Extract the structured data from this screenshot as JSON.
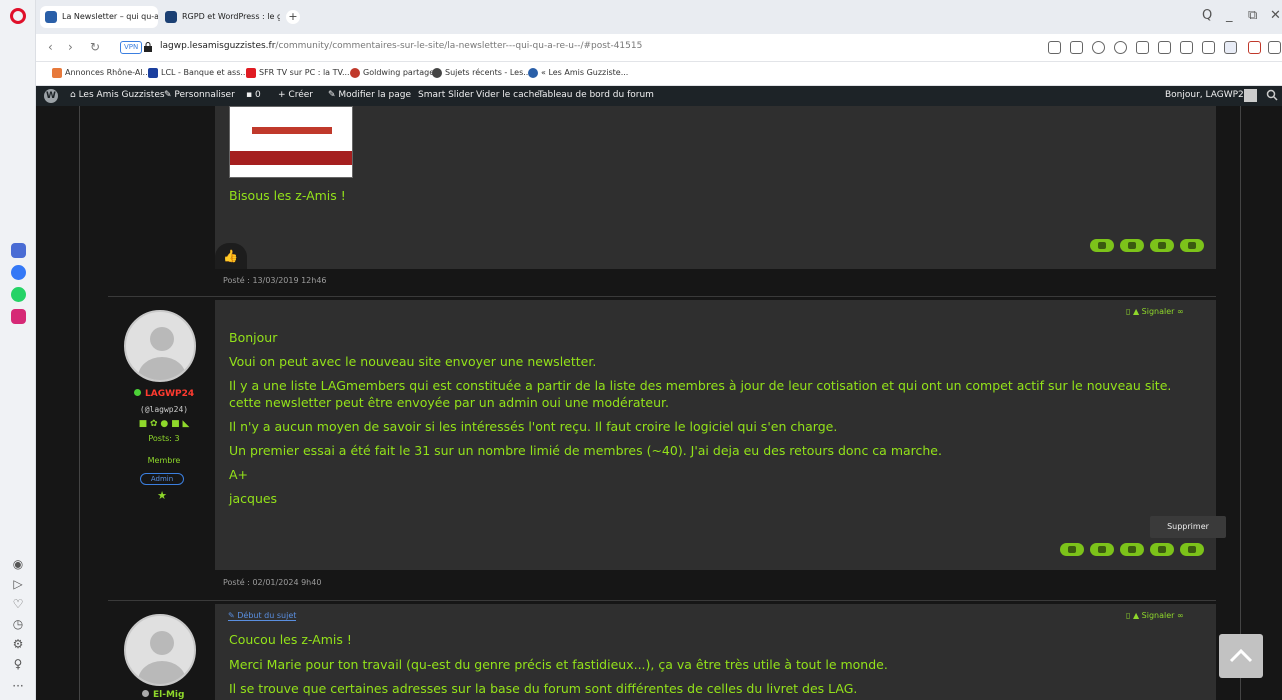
{
  "browser": {
    "tabs": [
      {
        "label": "La Newsletter – qui qu-a-r…",
        "active": true
      },
      {
        "label": "RGPD et WordPress : le gu…",
        "active": false
      }
    ],
    "new_tab": "+",
    "window_controls": {
      "search": "Q",
      "minimize": "_",
      "restore": "⧉",
      "close": "✕"
    },
    "vpn": "VPN",
    "url_domain": "lagwp.lesamisguzzistes.fr",
    "url_path": "/community/commentaires-sur-le-site/la-newsletter---qui-qu-a-re-u--/#post-41515"
  },
  "bookmarks": [
    {
      "label": "Annonces Rhône-Al...",
      "color": "#e7793b"
    },
    {
      "label": "LCL - Banque et ass...",
      "color": "#1b3f9e"
    },
    {
      "label": "SFR TV sur PC : la TV...",
      "color": "#e01b22"
    },
    {
      "label": "Goldwing partage",
      "color": "#c0392b"
    },
    {
      "label": "Sujets récents - Les...",
      "color": "#444444"
    },
    {
      "label": "« Les Amis Guzziste...",
      "color": "#2a5fa8"
    }
  ],
  "wpbar": {
    "site": "Les Amis Guzzistes",
    "customize": "Personnaliser",
    "comments": "0",
    "create": "Créer",
    "edit": "Modifier la page",
    "slider": "Smart Slider",
    "cache": "Vider le cache",
    "forum_dashboard": "Tableau de bord du forum",
    "greeting": "Bonjour, LAGWP24"
  },
  "post1": {
    "text": "Bisous les z-Amis !",
    "posted": "Posté : 13/03/2019 12h46"
  },
  "post2": {
    "author": "LAGWP24",
    "handle": "(@lagwp24)",
    "posts": "Posts: 3",
    "role": "Membre",
    "badge": "Admin",
    "signaler": "Signaler",
    "lines": [
      "Bonjour",
      "Voui on peut avec le nouveau site envoyer une newsletter.",
      "Il y a une liste LAGmembers qui est constituée a partir de la liste des membres à jour de leur cotisation et qui ont un compet actif sur le nouveau site.",
      "cette newsletter peut être envoyée par un admin oui une modérateur.",
      "Il n'y a aucun moyen de savoir si les intéressés l'ont reçu. Il faut croire le logiciel qui s'en charge.",
      "Un premier essai a été fait le 31 sur un nombre limié de membres (~40). J'ai deja eu des retours donc ca marche.",
      "A+",
      "jacques"
    ],
    "tooltip": "Supprimer",
    "posted": "Posté : 02/01/2024 9h40"
  },
  "post3": {
    "author": "El-Mig",
    "topic_start": "Début du sujet",
    "signaler": "Signaler",
    "lines": [
      "Coucou les z-Amis !",
      "Merci Marie pour ton travail (qu-est du genre précis et fastidieux...), ça va être très utile à tout le monde.",
      "Il se trouve que certaines adresses sur la base du forum sont différentes de celles du livret des LAG."
    ]
  }
}
